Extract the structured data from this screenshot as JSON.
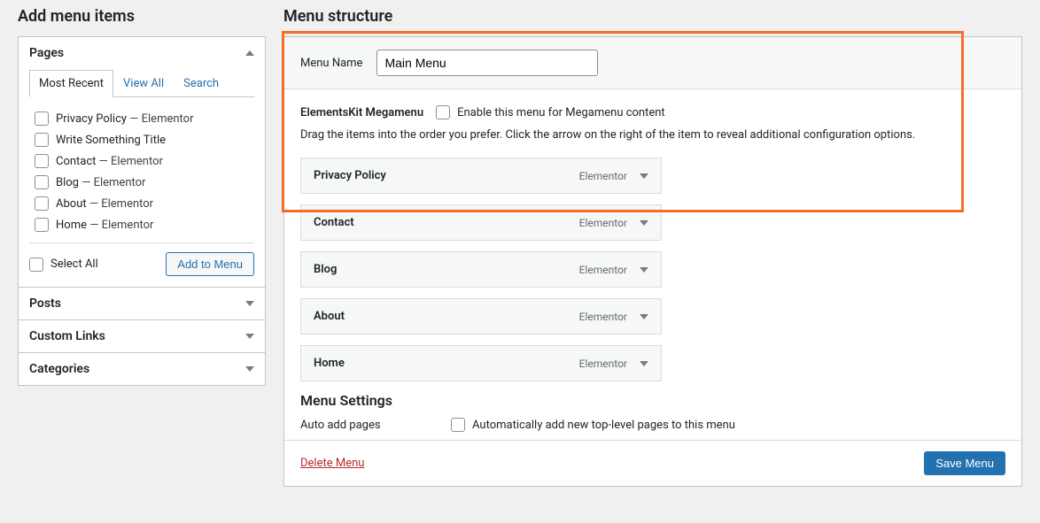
{
  "left": {
    "heading": "Add menu items",
    "pages_box": {
      "title": "Pages",
      "tabs": [
        {
          "label": "Most Recent",
          "active": true
        },
        {
          "label": "View All",
          "active": false
        },
        {
          "label": "Search",
          "active": false
        }
      ],
      "items": [
        {
          "title": "Privacy Policy",
          "suffix": " — Elementor"
        },
        {
          "title": "Write Something Title",
          "suffix": ""
        },
        {
          "title": "Contact",
          "suffix": " — Elementor"
        },
        {
          "title": "Blog",
          "suffix": " — Elementor"
        },
        {
          "title": "About",
          "suffix": " — Elementor"
        },
        {
          "title": "Home",
          "suffix": " — Elementor"
        }
      ],
      "select_all": "Select All",
      "add_button": "Add to Menu"
    },
    "other_boxes": [
      {
        "title": "Posts"
      },
      {
        "title": "Custom Links"
      },
      {
        "title": "Categories"
      }
    ]
  },
  "right": {
    "heading": "Menu structure",
    "menu_name_label": "Menu Name",
    "menu_name_value": "Main Menu",
    "megamenu": {
      "title": "ElementsKit Megamenu",
      "checkbox_label": "Enable this menu for Megamenu content"
    },
    "instructions": "Drag the items into the order you prefer. Click the arrow on the right of the item to reveal additional configuration options.",
    "items": [
      {
        "title": "Privacy Policy",
        "type": "Elementor"
      },
      {
        "title": "Contact",
        "type": "Elementor"
      },
      {
        "title": "Blog",
        "type": "Elementor"
      },
      {
        "title": "About",
        "type": "Elementor"
      },
      {
        "title": "Home",
        "type": "Elementor"
      }
    ],
    "settings": {
      "heading": "Menu Settings",
      "auto_add": {
        "label": "Auto add pages",
        "checkbox_label": "Automatically add new top-level pages to this menu"
      }
    },
    "footer": {
      "delete": "Delete Menu",
      "save": "Save Menu"
    }
  }
}
